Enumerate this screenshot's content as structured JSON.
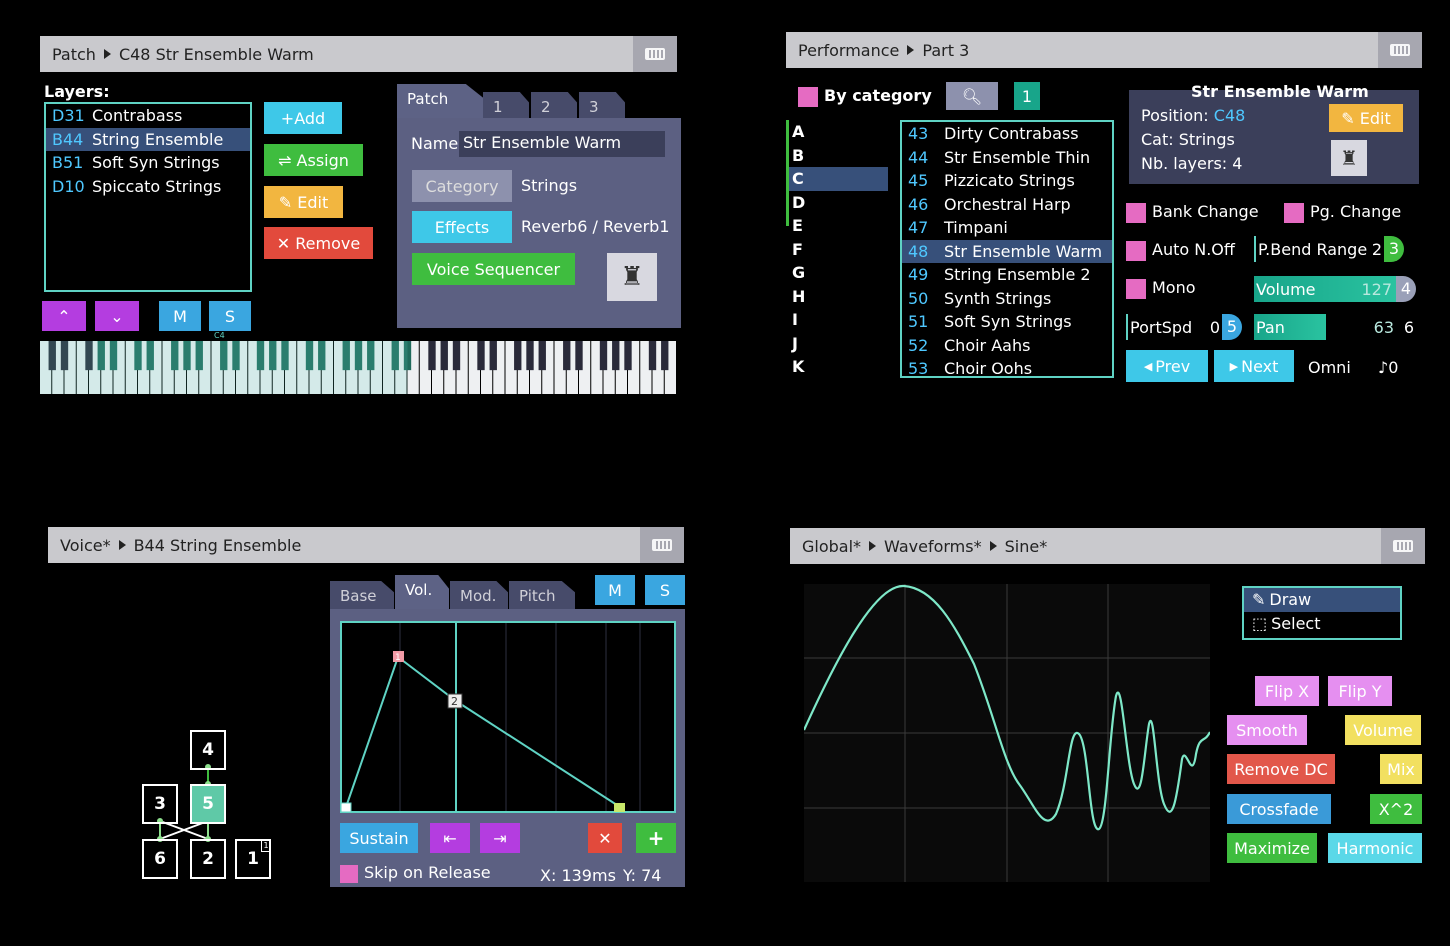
{
  "patch_screen": {
    "breadcrumb": [
      "Patch",
      "C48 Str Ensemble Warm"
    ],
    "layers_label": "Layers:",
    "layers": [
      {
        "code": "D31",
        "name": "Contrabass"
      },
      {
        "code": "B44",
        "name": "String Ensemble"
      },
      {
        "code": "B51",
        "name": "Soft Syn Strings"
      },
      {
        "code": "D10",
        "name": "Spiccato Strings"
      }
    ],
    "buttons": {
      "add": "+Add",
      "assign": "⇌ Assign",
      "edit": "✎ Edit",
      "remove": "✕ Remove"
    },
    "mute_solo": {
      "m": "M",
      "s": "S"
    },
    "keyboard_marker": "C4",
    "tabs": [
      "Patch",
      "1",
      "2",
      "3"
    ],
    "name_label": "Name:",
    "name_value": "Str Ensemble Warm",
    "category_btn": "Category",
    "category_value": "Strings",
    "effects_btn": "Effects",
    "effects_value": "Reverb6 / Reverb1",
    "voice_seq_btn": "Voice Sequencer"
  },
  "performance_screen": {
    "breadcrumb": [
      "Performance",
      "Part 3"
    ],
    "by_category": "By category",
    "filter_num": "1",
    "letters": [
      "A",
      "B",
      "C",
      "D",
      "E",
      "F",
      "G",
      "H",
      "I",
      "J",
      "K"
    ],
    "patches": [
      {
        "num": "43",
        "name": "Dirty Contrabass"
      },
      {
        "num": "44",
        "name": "Str Ensemble Thin"
      },
      {
        "num": "45",
        "name": "Pizzicato Strings"
      },
      {
        "num": "46",
        "name": "Orchestral Harp"
      },
      {
        "num": "47",
        "name": "Timpani"
      },
      {
        "num": "48",
        "name": "Str Ensemble Warm"
      },
      {
        "num": "49",
        "name": "String Ensemble 2"
      },
      {
        "num": "50",
        "name": "Synth Strings"
      },
      {
        "num": "51",
        "name": "Soft Syn Strings"
      },
      {
        "num": "52",
        "name": "Choir Aahs"
      },
      {
        "num": "53",
        "name": "Choir Oohs"
      }
    ],
    "info_title": "Str Ensemble Warm",
    "position_label": "Position:",
    "position_value": "C48",
    "cat_label": "Cat: Strings",
    "layers_label": "Nb. layers: 4",
    "edit_btn": "✎ Edit",
    "bank_change": "Bank Change",
    "pg_change": "Pg. Change",
    "auto_noff": "Auto N.Off",
    "pbend_label": "P.Bend Range",
    "pbend_value": "2",
    "pbend_knob": "3",
    "mono": "Mono",
    "volume_label": "Volume",
    "volume_value": "127",
    "volume_knob": "4",
    "volume_fraction": 1.0,
    "portspd_label": "PortSpd",
    "portspd_value": "0",
    "portspd_knob": "5",
    "pan_label": "Pan",
    "pan_value": "63",
    "pan_knob": "6",
    "prev": "Prev",
    "next": "Next",
    "omni": "Omni",
    "transpose": "♪0"
  },
  "voice_screen": {
    "breadcrumb": [
      "Voice*",
      "B44 String Ensemble"
    ],
    "tabs": [
      "Base",
      "Vol.",
      "Mod.",
      "Pitch"
    ],
    "m": "M",
    "s": "S",
    "operators": [
      "4",
      "3",
      "5",
      "6",
      "2",
      "1"
    ],
    "env_points": [
      "1",
      "2"
    ],
    "sustain": "Sustain",
    "skip_release": "Skip on Release",
    "x_readout": "X: 139ms",
    "y_readout": "Y: 74"
  },
  "waveform_screen": {
    "breadcrumb": [
      "Global*",
      "Waveforms*",
      "Sine*"
    ],
    "tools": [
      "Draw",
      "Select"
    ],
    "buttons": {
      "flip_x": "Flip X",
      "flip_y": "Flip Y",
      "smooth": "Smooth",
      "volume": "Volume",
      "remove_dc": "Remove DC",
      "mix": "Mix",
      "crossfade": "Crossfade",
      "x2": "X^2",
      "maximize": "Maximize",
      "harmonic": "Harmonic"
    }
  },
  "colors": {
    "title_bg": "#c9c9cd",
    "accent_teal": "#5fd3c4",
    "purple": "#b43de0",
    "blue": "#3aa6e0",
    "green": "#3fbd3f",
    "orange": "#f2b640",
    "red": "#e24a3c",
    "pink": "#e56bc2"
  }
}
